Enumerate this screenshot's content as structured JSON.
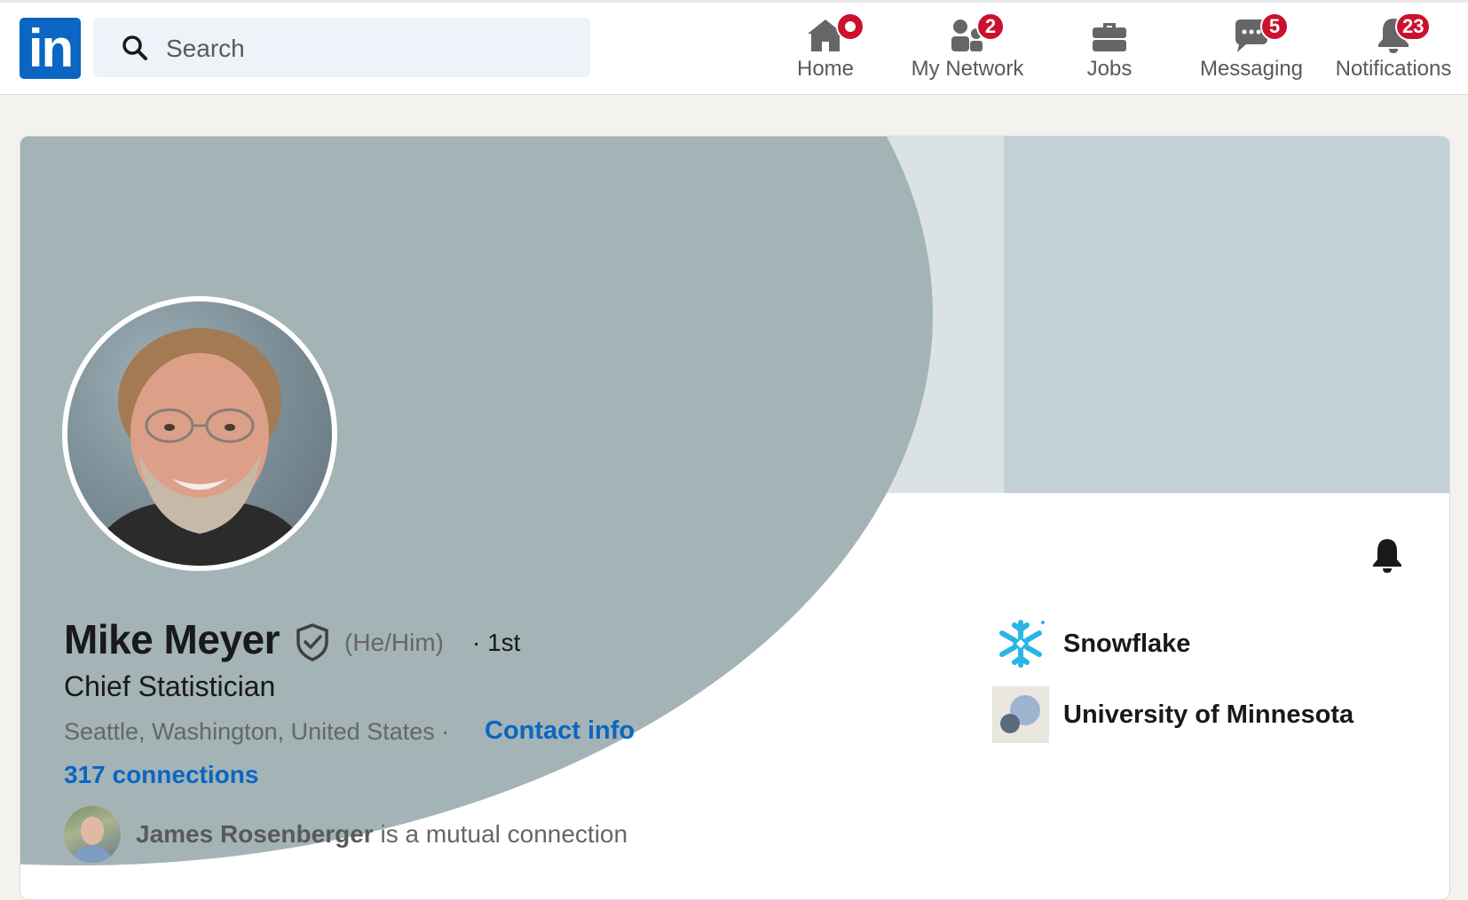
{
  "nav": {
    "logo_text": "in",
    "search_placeholder": "Search",
    "items": [
      {
        "label": "Home",
        "icon": "home-icon",
        "badge": null,
        "has_dot": true
      },
      {
        "label": "My Network",
        "icon": "network-icon",
        "badge": "2",
        "has_dot": false
      },
      {
        "label": "Jobs",
        "icon": "briefcase-icon",
        "badge": null,
        "has_dot": false
      },
      {
        "label": "Messaging",
        "icon": "messaging-icon",
        "badge": "5",
        "has_dot": false
      },
      {
        "label": "Notifications",
        "icon": "bell-icon",
        "badge": "23",
        "has_dot": false
      }
    ]
  },
  "profile": {
    "name": "Mike Meyer",
    "pronouns": "(He/Him)",
    "degree": "· 1st",
    "headline": "Chief Statistician",
    "location": "Seattle, Washington, United States ·",
    "contact_label": "Contact info",
    "connections": "317 connections",
    "mutual": {
      "name": "James Rosenberger",
      "suffix": " is a mutual connection"
    },
    "companies": [
      {
        "name": "Snowflake",
        "icon": "snowflake-logo"
      },
      {
        "name": "University of Minnesota",
        "icon": "school-placeholder-logo"
      }
    ]
  },
  "colors": {
    "brand": "#0a66c2",
    "badge": "#cb112d",
    "banner_dark": "#a3b3b6",
    "banner_light": "#c2d1d6"
  }
}
